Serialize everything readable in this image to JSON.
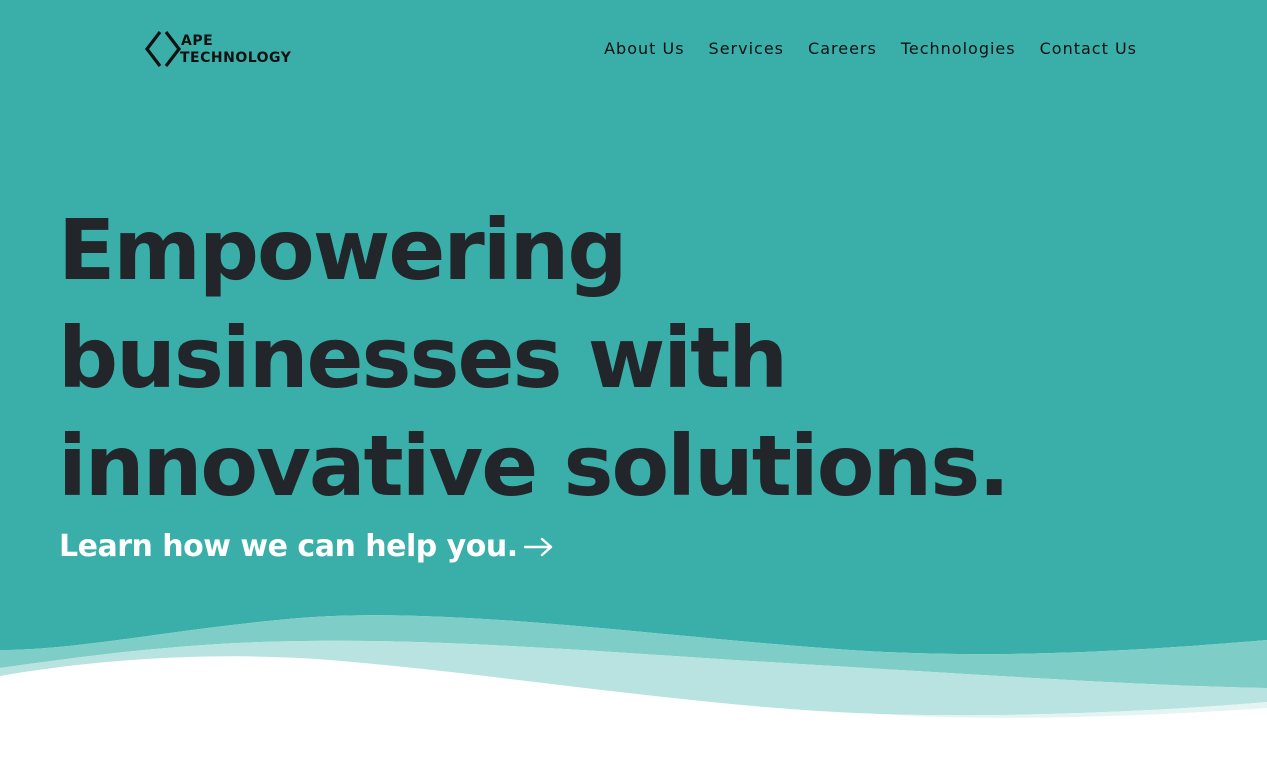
{
  "brand": {
    "logo_line1": "APE",
    "logo_line2": "TECHNOLOGY"
  },
  "nav": {
    "items": [
      {
        "label": "About Us"
      },
      {
        "label": "Services"
      },
      {
        "label": "Careers"
      },
      {
        "label": "Technologies"
      },
      {
        "label": "Contact Us"
      }
    ]
  },
  "hero": {
    "headline_lines": [
      "Empowering",
      "businesses with",
      "innovative solutions."
    ],
    "cta_label": "Learn how we can help you.",
    "cta_icon": "arrow-right-icon"
  },
  "colors": {
    "hero_background": "#3aafa9",
    "headline_text": "#222529",
    "cta_text": "#ffffff",
    "nav_text": "#111111",
    "page_background": "#ffffff"
  }
}
